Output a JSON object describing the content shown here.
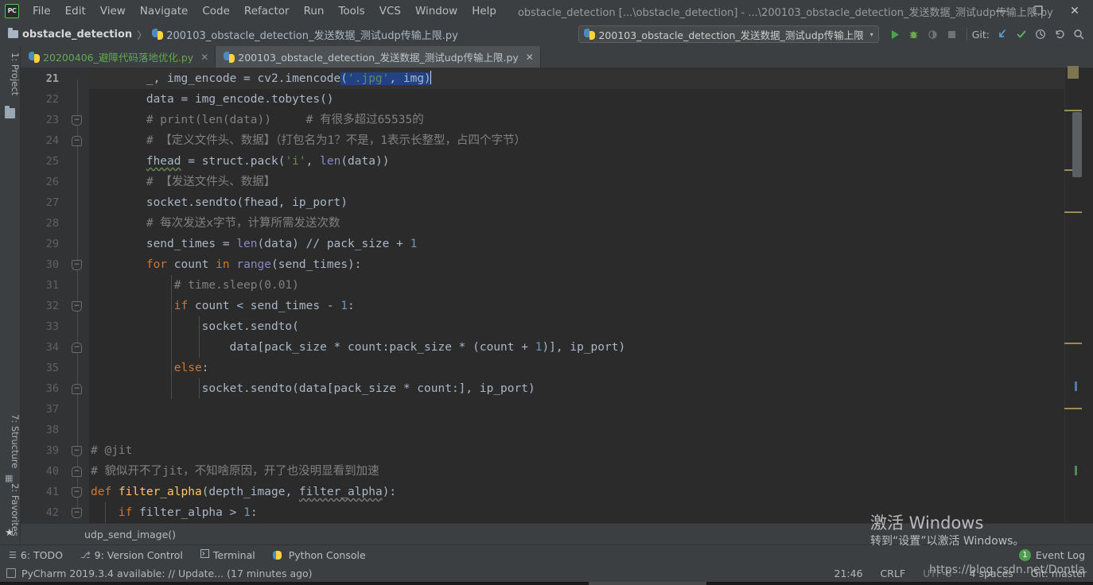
{
  "window": {
    "title": "obstacle_detection [...\\obstacle_detection] - ...\\200103_obstacle_detection_发送数据_测试udp传输上限.py",
    "logo": "PC",
    "minimize": "—",
    "maximize": "❐",
    "close": "✕"
  },
  "menu": [
    {
      "label": "File"
    },
    {
      "label": "Edit"
    },
    {
      "label": "View"
    },
    {
      "label": "Navigate"
    },
    {
      "label": "Code"
    },
    {
      "label": "Refactor"
    },
    {
      "label": "Run"
    },
    {
      "label": "Tools"
    },
    {
      "label": "VCS"
    },
    {
      "label": "Window"
    },
    {
      "label": "Help"
    }
  ],
  "breadcrumb": {
    "project": "obstacle_detection",
    "separator": "〉",
    "file": "200103_obstacle_detection_发送数据_测试udp传输上限.py"
  },
  "toolbar": {
    "run_config": "200103_obstacle_detection_发送数据_测试udp传输上限",
    "chevron": "▾",
    "run": "▶",
    "debug": "ὁE",
    "coverage": "◑",
    "stop": "■",
    "git_label": "Git:",
    "git_update": "↙",
    "git_commit": "✓",
    "git_history": "◴",
    "git_rollback": "↺",
    "search": "⌕"
  },
  "left_strip": {
    "project": "1: Project",
    "structure": "7: Structure",
    "favorites": "2: Favorites",
    "favorites_icon": "★",
    "structure_icon": "▦"
  },
  "editor_tabs": [
    {
      "label": "20200406_避障代码落地优化.py",
      "active": false,
      "close": "✕"
    },
    {
      "label": "200103_obstacle_detection_发送数据_测试udp传输上限.py",
      "active": true,
      "close": "✕"
    }
  ],
  "editor": {
    "first_line_number": 21,
    "breadcrumb": "udp_send_image()",
    "lines": [
      {
        "n": 21,
        "current": true,
        "fold": null,
        "indent": 0
      },
      {
        "n": 22,
        "current": false,
        "fold": null,
        "indent": 0
      },
      {
        "n": 23,
        "current": false,
        "fold": "open",
        "indent": 0
      },
      {
        "n": 24,
        "current": false,
        "fold": "endtag",
        "indent": 0
      },
      {
        "n": 25,
        "current": false,
        "fold": null,
        "indent": 0
      },
      {
        "n": 26,
        "current": false,
        "fold": null,
        "indent": 0
      },
      {
        "n": 27,
        "current": false,
        "fold": null,
        "indent": 0
      },
      {
        "n": 28,
        "current": false,
        "fold": null,
        "indent": 0
      },
      {
        "n": 29,
        "current": false,
        "fold": null,
        "indent": 0
      },
      {
        "n": 30,
        "current": false,
        "fold": "open",
        "indent": 0
      },
      {
        "n": 31,
        "current": false,
        "fold": null,
        "indent": 0
      },
      {
        "n": 32,
        "current": false,
        "fold": "open",
        "indent": 0
      },
      {
        "n": 33,
        "current": false,
        "fold": null,
        "indent": 0
      },
      {
        "n": 34,
        "current": false,
        "fold": "endtag",
        "indent": 0
      },
      {
        "n": 35,
        "current": false,
        "fold": null,
        "indent": 0
      },
      {
        "n": 36,
        "current": false,
        "fold": "endtag",
        "indent": 0
      },
      {
        "n": 37,
        "current": false,
        "fold": null,
        "indent": 0
      },
      {
        "n": 38,
        "current": false,
        "fold": null,
        "indent": 0
      },
      {
        "n": 39,
        "current": false,
        "fold": "open",
        "indent": 0
      },
      {
        "n": 40,
        "current": false,
        "fold": "endtag",
        "indent": 0
      },
      {
        "n": 41,
        "current": false,
        "fold": "open",
        "indent": 0
      },
      {
        "n": 42,
        "current": false,
        "fold": "open",
        "indent": 0
      }
    ],
    "code": [
      "        _, img_encode = cv2.imencode('.jpg', img)",
      "        data = img_encode.tobytes()",
      "        # print(len(data))     # 有很多超过65535的",
      "        # 【定义文件头、数据】（打包名为1？不是，1表示长整型，占四个字节）",
      "        fhead = struct.pack('i', len(data))",
      "        # 【发送文件头、数据】",
      "        socket.sendto(fhead, ip_port)",
      "        # 每次发送x字节，计算所需发送次数",
      "        send_times = len(data) // pack_size + 1",
      "        for count in range(send_times):",
      "            # time.sleep(0.01)",
      "            if count < send_times - 1:",
      "                socket.sendto(",
      "                    data[pack_size * count:pack_size * (count + 1)], ip_port)",
      "            else:",
      "                socket.sendto(data[pack_size * count:], ip_port)",
      "",
      "",
      "# @jit",
      "# 貌似开不了jit，不知啥原因，开了也没明显看到加速",
      "def filter_alpha(depth_image, filter_alpha):",
      "    if filter_alpha > 1:"
    ]
  },
  "bottom_tools": [
    {
      "icon": "☰",
      "label": "6: TODO"
    },
    {
      "icon": "⎇",
      "label": "9: Version Control"
    },
    {
      "icon": "▸",
      "label": "Terminal"
    },
    {
      "icon": "ὀD",
      "label": "Python Console"
    }
  ],
  "event_log": {
    "count": "1",
    "label": "Event Log"
  },
  "status_bar": {
    "message": "PyCharm 2019.3.4 available: // Update... (17 minutes ago)",
    "time": "21:46",
    "line_separator": "CRLF",
    "encoding": "UTF-8",
    "indent": "4 spaces",
    "git_branch": "Git: master"
  },
  "watermarks": {
    "windows_line1": "激活 Windows",
    "windows_line2": "转到“设置”以激活 Windows。",
    "csdn": "https://blog.csdn.net/Dontla"
  },
  "colors": {
    "chrome": "#3c3f41",
    "editor_bg": "#2b2b2b",
    "gutter_bg": "#313335",
    "text": "#a9b7c6",
    "keyword": "#cc7832",
    "string": "#6a8759",
    "number": "#6897bb",
    "comment": "#808080",
    "function_def": "#ffc66d",
    "accent_green": "#4ea44e",
    "tab_modified": "#62a850"
  }
}
